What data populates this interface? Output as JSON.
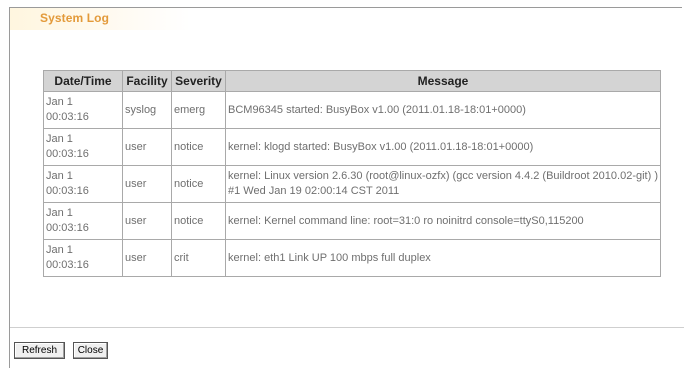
{
  "page": {
    "title": "System Log",
    "accent_color": "#e39a3a"
  },
  "table": {
    "headers": [
      "Date/Time",
      "Facility",
      "Severity",
      "Message"
    ],
    "rows": [
      {
        "date": "Jan 1",
        "time": "00:03:16",
        "facility": "syslog",
        "severity": "emerg",
        "message": "BCM96345 started: BusyBox v1.00 (2011.01.18-18:01+0000)"
      },
      {
        "date": "Jan 1",
        "time": "00:03:16",
        "facility": "user",
        "severity": "notice",
        "message": "kernel: klogd started: BusyBox v1.00 (2011.01.18-18:01+0000)"
      },
      {
        "date": "Jan 1",
        "time": "00:03:16",
        "facility": "user",
        "severity": "notice",
        "message": "kernel: Linux version 2.6.30 (root@linux-ozfx) (gcc version 4.4.2 (Buildroot 2010.02-git) ) #1 Wed Jan 19 02:00:14 CST 2011"
      },
      {
        "date": "Jan 1",
        "time": "00:03:16",
        "facility": "user",
        "severity": "notice",
        "message": "kernel: Kernel command line: root=31:0 ro noinitrd console=ttyS0,115200"
      },
      {
        "date": "Jan 1",
        "time": "00:03:16",
        "facility": "user",
        "severity": "crit",
        "message": "kernel: eth1 Link UP 100 mbps full duplex"
      }
    ]
  },
  "buttons": {
    "refresh_label": "Refresh",
    "close_label": "Close"
  }
}
